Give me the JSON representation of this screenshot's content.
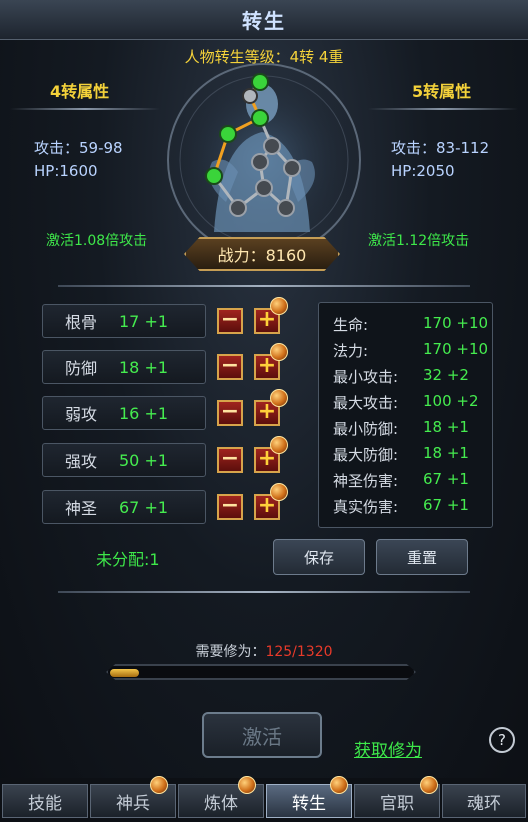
{
  "window": {
    "title": "转生"
  },
  "rebirth": {
    "level_label": "人物转生等级：4转 4重",
    "current": {
      "heading": "4转属性",
      "attack": "攻击：59-98",
      "hp": "HP:1600",
      "activate": "激活1.08倍攻击"
    },
    "next": {
      "heading": "5转属性",
      "attack": "攻击：83-112",
      "hp": "HP:2050",
      "activate": "激活1.12倍攻击"
    },
    "combat_power": "战力：8160"
  },
  "attributes": [
    {
      "name": "根骨",
      "value": "17 +1"
    },
    {
      "name": "防御",
      "value": "18 +1"
    },
    {
      "name": "弱攻",
      "value": "16 +1"
    },
    {
      "name": "强攻",
      "value": "50 +1"
    },
    {
      "name": "神圣",
      "value": "67 +1"
    }
  ],
  "buttons": {
    "minus": "−",
    "plus": "+",
    "save": "保存",
    "reset": "重置",
    "activate": "激活",
    "get_cultivation": "获取修为",
    "help": "?"
  },
  "summary": [
    {
      "key": "生命:",
      "value": "170 +10"
    },
    {
      "key": "法力:",
      "value": "170 +10"
    },
    {
      "key": "最小攻击:",
      "value": "32 +2"
    },
    {
      "key": "最大攻击:",
      "value": "100 +2"
    },
    {
      "key": "最小防御:",
      "value": "18 +1"
    },
    {
      "key": "最大防御:",
      "value": "18 +1"
    },
    {
      "key": "神圣伤害:",
      "value": "67 +1"
    },
    {
      "key": "真实伤害:",
      "value": "67 +1"
    }
  ],
  "unallocated": "未分配:1",
  "cultivation": {
    "label": "需要修为：",
    "value": "125/1320",
    "progress": 0.095
  },
  "tabs": [
    {
      "label": "技能",
      "active": false
    },
    {
      "label": "神兵",
      "active": false
    },
    {
      "label": "炼体",
      "active": false
    },
    {
      "label": "转生",
      "active": true
    },
    {
      "label": "官职",
      "active": false
    },
    {
      "label": "魂环",
      "active": false
    }
  ],
  "colors": {
    "accent_gold": "#f4d23a",
    "value_green": "#45ec4f",
    "need_red": "#e83a2a",
    "stat_blue": "#b9d3ff"
  },
  "icons": [
    "constellation-figure-icon",
    "plus-icon",
    "minus-icon",
    "orb-badge-icon",
    "help-icon"
  ]
}
